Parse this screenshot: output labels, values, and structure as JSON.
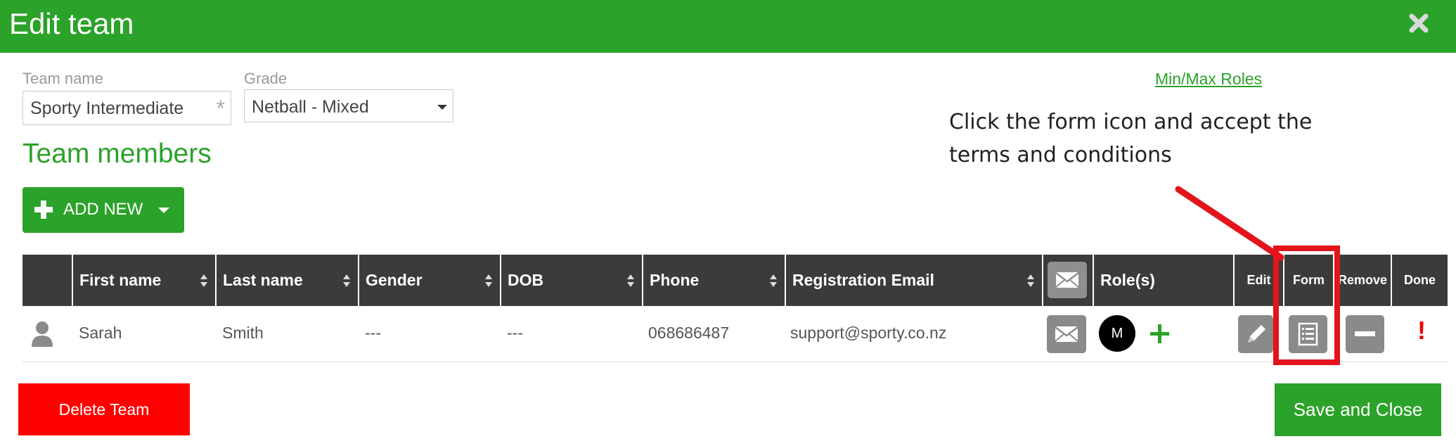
{
  "header": {
    "title": "Edit team",
    "close_icon": "close-icon"
  },
  "form": {
    "team_name_label": "Team name",
    "team_name_value": "Sporty Intermediate",
    "required_mark": "*",
    "grade_label": "Grade",
    "grade_value": "Netball - Mixed"
  },
  "links": {
    "min_max_roles": "Min/Max Roles"
  },
  "instruction": "Click the form icon and accept the terms and conditions",
  "section_title": "Team members",
  "add_new": {
    "label": "ADD NEW"
  },
  "table": {
    "headers": {
      "first_name": "First name",
      "last_name": "Last name",
      "gender": "Gender",
      "dob": "DOB",
      "phone": "Phone",
      "registration_email": "Registration Email",
      "roles": "Role(s)",
      "edit": "Edit",
      "form": "Form",
      "remove": "Remove",
      "done": "Done"
    },
    "rows": [
      {
        "first_name": "Sarah",
        "last_name": "Smith",
        "gender": "---",
        "dob": "---",
        "phone": "068686487",
        "registration_email": "support@sporty.co.nz",
        "role_badge": "M",
        "done_status": "!"
      }
    ]
  },
  "footer": {
    "delete_label": "Delete Team",
    "save_label": "Save and Close"
  },
  "colors": {
    "brand_green": "#2ba229",
    "header_dark": "#3b3b3b",
    "danger_red": "#ff0000",
    "annotation_red": "#e3141b"
  }
}
